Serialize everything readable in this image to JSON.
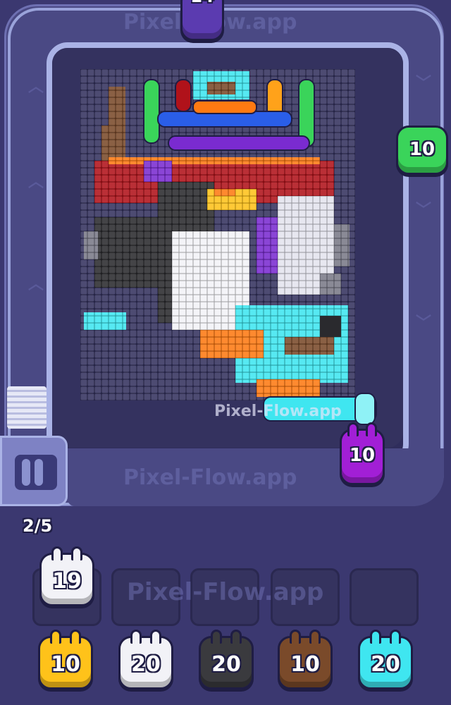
{
  "watermark": "Pixel-Flow.app",
  "board_watermark": "Pixel-Flow.app",
  "progress": "2/5",
  "track_characters": [
    {
      "name": "purple-top",
      "count": "14",
      "color": "#5b3bb0"
    },
    {
      "name": "green-right",
      "count": "10",
      "color": "#3ad45a"
    },
    {
      "name": "purple-bottom",
      "count": "10",
      "color": "#a21fd6"
    }
  ],
  "queue_slots": [
    {
      "count": "19",
      "color": "#f2f2f7"
    },
    {
      "count": "",
      "color": ""
    },
    {
      "count": "",
      "color": ""
    },
    {
      "count": "",
      "color": ""
    },
    {
      "count": "",
      "color": ""
    }
  ],
  "waiting_characters": [
    {
      "count": "10",
      "color": "#ffc21a"
    },
    {
      "count": "20",
      "color": "#f2f2f7"
    },
    {
      "count": "20",
      "color": "#3a3a3e"
    },
    {
      "count": "10",
      "color": "#7a4a2a"
    },
    {
      "count": "20",
      "color": "#3fe6f0"
    }
  ],
  "colors": {
    "background": "#3b3870",
    "track": "#4a4984",
    "board": "#34325f",
    "rail": "#aab3e6"
  }
}
